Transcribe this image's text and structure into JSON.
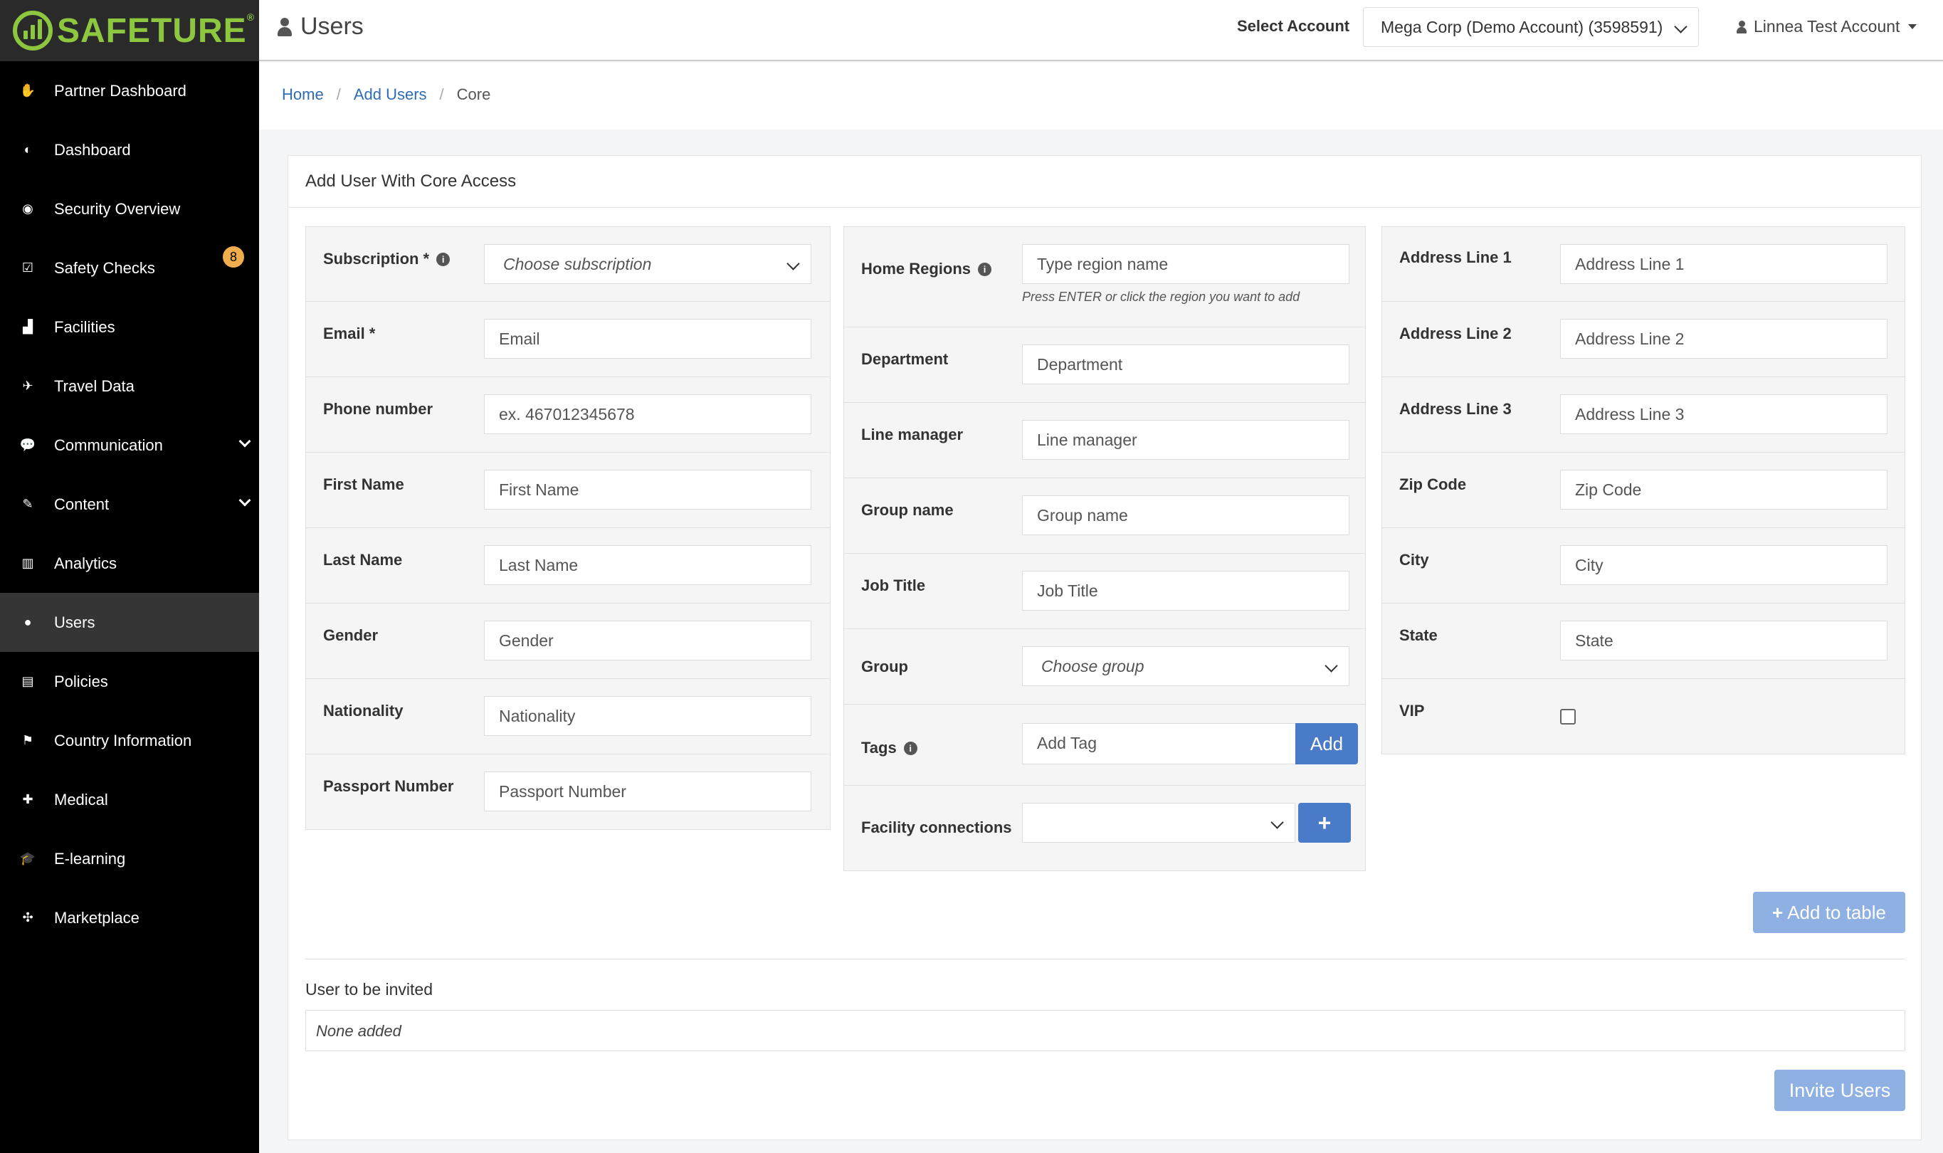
{
  "brand": {
    "name": "SAFETURE",
    "reg": "®"
  },
  "sidebar": {
    "items": [
      {
        "label": "Partner Dashboard",
        "icon": "handshake-icon",
        "glyph": "✋"
      },
      {
        "label": "Dashboard",
        "icon": "dashboard-icon",
        "glyph": "◐"
      },
      {
        "label": "Security Overview",
        "icon": "globe-icon",
        "glyph": "◉"
      },
      {
        "label": "Safety Checks",
        "icon": "checkbox-icon",
        "glyph": "☑",
        "badge": "8"
      },
      {
        "label": "Facilities",
        "icon": "bar-chart-icon",
        "glyph": "▟"
      },
      {
        "label": "Travel Data",
        "icon": "plane-icon",
        "glyph": "✈"
      },
      {
        "label": "Communication",
        "icon": "chat-icon",
        "glyph": "💬"
      },
      {
        "label": "Content",
        "icon": "edit-icon",
        "glyph": "✎"
      },
      {
        "label": "Analytics",
        "icon": "analytics-icon",
        "glyph": "▥"
      },
      {
        "label": "Users",
        "icon": "user-icon",
        "glyph": "●"
      },
      {
        "label": "Policies",
        "icon": "list-icon",
        "glyph": "▤"
      },
      {
        "label": "Country Information",
        "icon": "flag-icon",
        "glyph": "⚑"
      },
      {
        "label": "Medical",
        "icon": "medkit-icon",
        "glyph": "✚"
      },
      {
        "label": "E-learning",
        "icon": "graduation-cap-icon",
        "glyph": "🎓"
      },
      {
        "label": "Marketplace",
        "icon": "puzzle-icon",
        "glyph": "✣"
      }
    ],
    "active": "Users"
  },
  "header": {
    "title": "Users",
    "select_account_label": "Select Account",
    "account_value": "Mega Corp (Demo Account) (3598591)",
    "user_name": "Linnea Test Account"
  },
  "breadcrumb": {
    "home": "Home",
    "add_users": "Add Users",
    "current": "Core"
  },
  "card": {
    "title": "Add User With Core Access"
  },
  "form": {
    "col1": [
      {
        "label": "Subscription *",
        "placeholder": "Choose subscription",
        "type": "select",
        "info": true
      },
      {
        "label": "Email *",
        "placeholder": "Email"
      },
      {
        "label": "Phone number",
        "placeholder": "ex. 467012345678"
      },
      {
        "label": "First Name",
        "placeholder": "First Name"
      },
      {
        "label": "Last Name",
        "placeholder": "Last Name"
      },
      {
        "label": "Gender",
        "placeholder": "Gender"
      },
      {
        "label": "Nationality",
        "placeholder": "Nationality"
      },
      {
        "label": "Passport Number",
        "placeholder": "Passport Number"
      }
    ],
    "col2": {
      "home_regions": {
        "label": "Home Regions",
        "placeholder": "Type region name",
        "hint": "Press ENTER or click the region you want to add"
      },
      "department": {
        "label": "Department",
        "placeholder": "Department"
      },
      "line_manager": {
        "label": "Line manager",
        "placeholder": "Line manager"
      },
      "group_name": {
        "label": "Group name",
        "placeholder": "Group name"
      },
      "job_title": {
        "label": "Job Title",
        "placeholder": "Job Title"
      },
      "group": {
        "label": "Group",
        "placeholder": "Choose group"
      },
      "tags": {
        "label": "Tags",
        "placeholder": "Add Tag",
        "button": "Add"
      },
      "facility": {
        "label": "Facility connections",
        "button": "+"
      }
    },
    "col3": [
      {
        "label": "Address Line 1",
        "placeholder": "Address Line 1"
      },
      {
        "label": "Address Line 2",
        "placeholder": "Address Line 2"
      },
      {
        "label": "Address Line 3",
        "placeholder": "Address Line 3"
      },
      {
        "label": "Zip Code",
        "placeholder": "Zip Code"
      },
      {
        "label": "City",
        "placeholder": "City"
      },
      {
        "label": "State",
        "placeholder": "State"
      }
    ],
    "vip_label": "VIP"
  },
  "actions": {
    "add_to_table": "Add to table",
    "invited_title": "User to be invited",
    "none_added": "None added",
    "invite_users": "Invite Users"
  },
  "colors": {
    "brand_green": "#8dc63f",
    "primary_blue": "#4a7bc8",
    "disabled_blue": "#8fb0e2",
    "badge_orange": "#f0ad4e"
  }
}
